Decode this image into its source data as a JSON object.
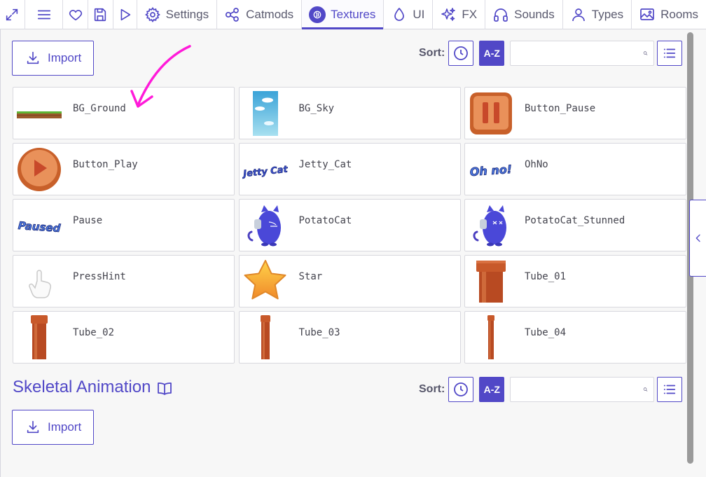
{
  "toolbar": {
    "icons": [
      "maximize-icon",
      "menu-icon",
      "heart-icon",
      "save-icon",
      "play-icon"
    ],
    "tabs": [
      {
        "label": "Settings",
        "icon": "gear-icon"
      },
      {
        "label": "Catmods",
        "icon": "nodes-icon"
      },
      {
        "label": "Textures",
        "icon": "texture-icon",
        "active": true
      },
      {
        "label": "UI",
        "icon": "droplet-icon"
      },
      {
        "label": "FX",
        "icon": "sparkles-icon"
      },
      {
        "label": "Sounds",
        "icon": "headphones-icon"
      },
      {
        "label": "Types",
        "icon": "user-icon"
      },
      {
        "label": "Rooms",
        "icon": "image-icon"
      }
    ]
  },
  "textures": {
    "import_label": "Import",
    "sort_label": "Sort:",
    "sort_az_label": "A-Z",
    "search_placeholder": "",
    "items": [
      {
        "name": "BG_Ground",
        "icon": "ground-strip"
      },
      {
        "name": "BG_Sky",
        "icon": "sky-strip"
      },
      {
        "name": "Button_Pause",
        "icon": "pause-button"
      },
      {
        "name": "Button_Play",
        "icon": "play-button"
      },
      {
        "name": "Jetty_Cat",
        "icon": "jetty-cat-logo"
      },
      {
        "name": "OhNo",
        "icon": "oh-no-logo"
      },
      {
        "name": "Pause",
        "icon": "paused-logo"
      },
      {
        "name": "PotatoCat",
        "icon": "potato-cat"
      },
      {
        "name": "PotatoCat_Stunned",
        "icon": "potato-cat-stunned"
      },
      {
        "name": "PressHint",
        "icon": "hand-pointer"
      },
      {
        "name": "Star",
        "icon": "star"
      },
      {
        "name": "Tube_01",
        "icon": "pipe-wide"
      },
      {
        "name": "Tube_02",
        "icon": "pipe-thin"
      },
      {
        "name": "Tube_03",
        "icon": "pipe-thin"
      },
      {
        "name": "Tube_04",
        "icon": "pipe-thinnest"
      }
    ],
    "logo_texts": {
      "jetty": "Jetty Cat",
      "ohno": "Oh no!",
      "paused": "Paused"
    }
  },
  "skeletal": {
    "title": "Skeletal Animation",
    "import_label": "Import",
    "sort_label": "Sort:",
    "sort_az_label": "A-Z"
  },
  "colors": {
    "accent": "#5148c7",
    "annotation": "#ff1ad9"
  }
}
